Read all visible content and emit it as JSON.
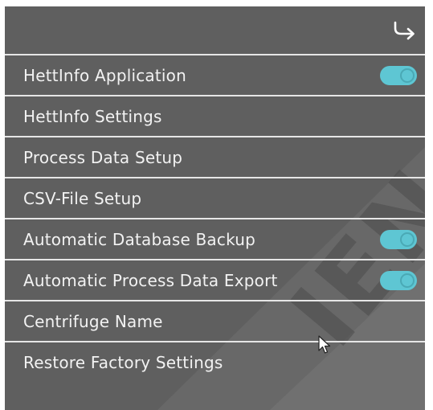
{
  "header": {
    "back_icon": "return-arrow-icon"
  },
  "menu": {
    "items": [
      {
        "label": "HettInfo Application",
        "toggle": true,
        "toggle_on": true
      },
      {
        "label": "HettInfo Settings",
        "toggle": false
      },
      {
        "label": "Process Data Setup",
        "toggle": false
      },
      {
        "label": "CSV-File Setup",
        "toggle": false
      },
      {
        "label": "Automatic Database Backup",
        "toggle": true,
        "toggle_on": true
      },
      {
        "label": "Automatic Process Data Export",
        "toggle": true,
        "toggle_on": true
      },
      {
        "label": "Centrifuge Name",
        "toggle": false
      },
      {
        "label": "Restore Factory Settings",
        "toggle": false
      }
    ]
  },
  "watermark": {
    "text": "IEN"
  },
  "colors": {
    "background": "#5f5f5f",
    "separator": "#e6e6e6",
    "text": "#f2f2f2",
    "toggle_accent": "#5ec6d3"
  }
}
